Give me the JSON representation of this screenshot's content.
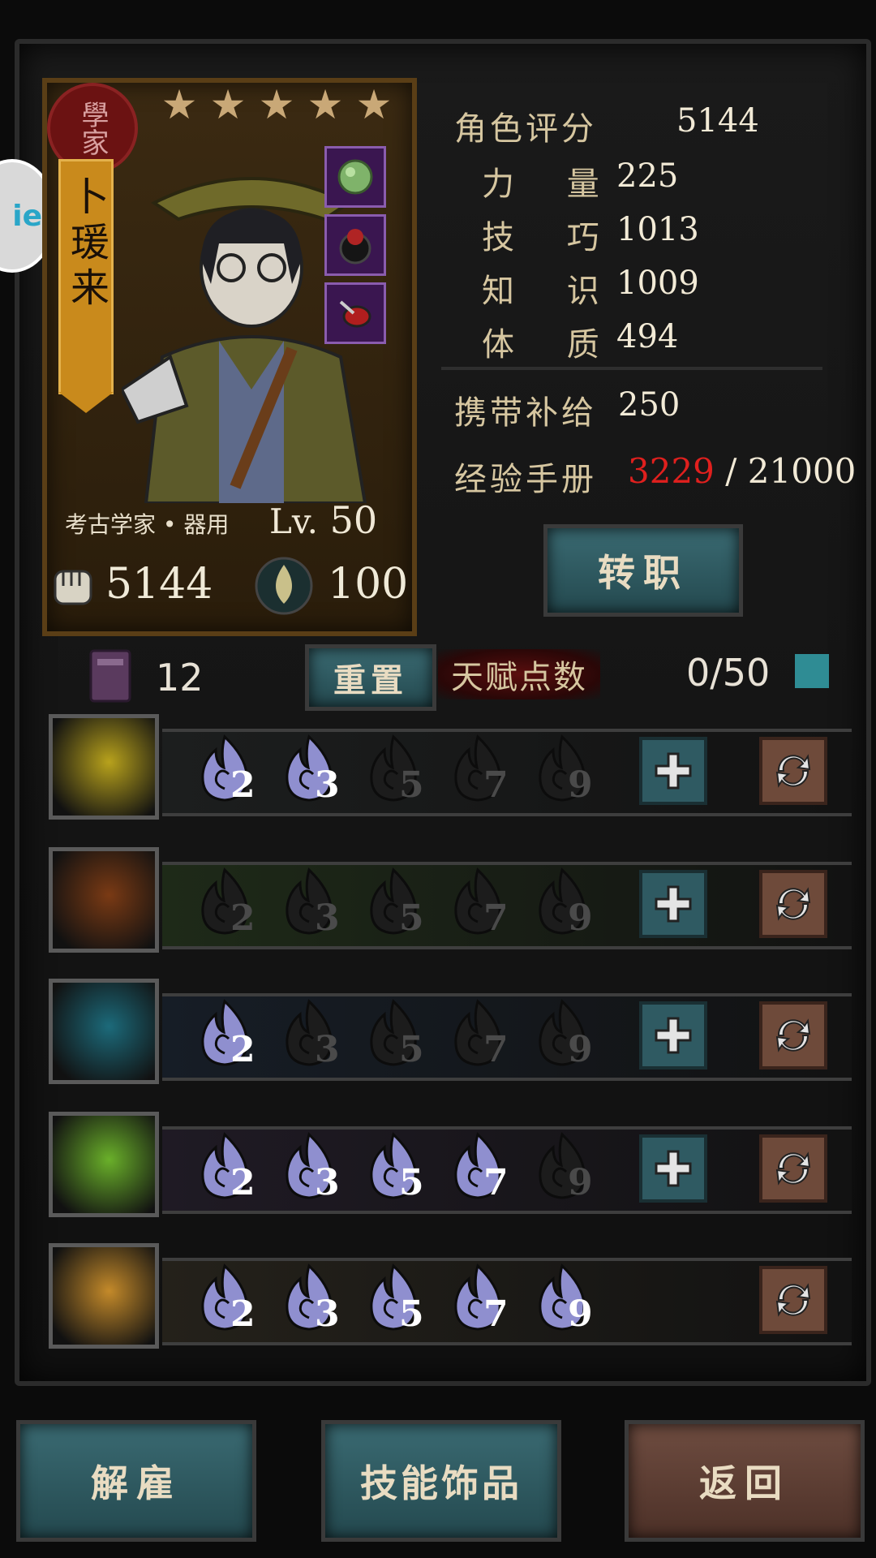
{
  "character": {
    "seal_text": "學家",
    "name": "卜瑗来",
    "stars": 5,
    "class_text": "考古学家 • 器用",
    "level_prefix": "Lv.",
    "level": "50",
    "power": "5144",
    "stress": "100"
  },
  "side_badge": {
    "text": "ie"
  },
  "stats": {
    "score_label": "角色评分",
    "score_value": "5144",
    "strength_label": "力 量",
    "strength_value": "225",
    "skill_label": "技 巧",
    "skill_value": "1013",
    "knowledge_label": "知 识",
    "knowledge_value": "1009",
    "constitution_label": "体 质",
    "constitution_value": "494",
    "supply_label": "携带补给",
    "supply_value": "250",
    "exp_label": "经验手册",
    "exp_current": "3229",
    "exp_max": "/ 21000"
  },
  "buttons": {
    "job_change": "转职",
    "reset": "重置",
    "dismiss": "解雇",
    "skill_trinket": "技能饰品",
    "back": "返回"
  },
  "talent": {
    "book_count": "12",
    "points_label": "天赋点数",
    "points_value": "0/50"
  },
  "skills": [
    {
      "name": "slash-skill",
      "pips": [
        "2",
        "3",
        "5",
        "7",
        "9"
      ],
      "active": 2,
      "has_plus": true,
      "icon_color": "#b8a21c"
    },
    {
      "name": "fire-fist-skill",
      "pips": [
        "2",
        "3",
        "5",
        "7",
        "9"
      ],
      "active": 0,
      "has_plus": true,
      "icon_color": "#7a3a14"
    },
    {
      "name": "shadow-skill",
      "pips": [
        "2",
        "3",
        "5",
        "7",
        "9"
      ],
      "active": 1,
      "has_plus": true,
      "icon_color": "#1c6a7a"
    },
    {
      "name": "grab-skill",
      "pips": [
        "2",
        "3",
        "5",
        "7",
        "9"
      ],
      "active": 4,
      "has_plus": true,
      "icon_color": "#6ab02a"
    },
    {
      "name": "fury-skill",
      "pips": [
        "2",
        "3",
        "5",
        "7",
        "9"
      ],
      "active": 5,
      "has_plus": false,
      "icon_color": "#c48a2a"
    }
  ],
  "colors": {
    "exp_current": "#e0201e",
    "pip_on": "#8f8fcf",
    "pip_off": "#1c1c1c"
  }
}
